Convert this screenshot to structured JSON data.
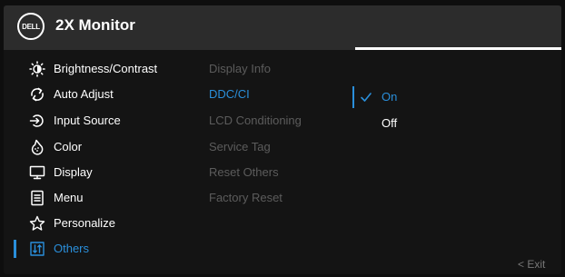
{
  "header": {
    "title": "2X Monitor",
    "logo_text": "DELL",
    "progress_fraction": 0.37
  },
  "nav": {
    "items": [
      {
        "label": "Brightness/Contrast",
        "icon": "brightness-icon"
      },
      {
        "label": "Auto Adjust",
        "icon": "auto-adjust-icon"
      },
      {
        "label": "Input Source",
        "icon": "input-source-icon"
      },
      {
        "label": "Color",
        "icon": "color-icon"
      },
      {
        "label": "Display",
        "icon": "display-icon"
      },
      {
        "label": "Menu",
        "icon": "menu-icon"
      },
      {
        "label": "Personalize",
        "icon": "star-icon"
      },
      {
        "label": "Others",
        "icon": "others-icon",
        "active": true
      }
    ]
  },
  "submenu": {
    "items": [
      {
        "label": "Display Info"
      },
      {
        "label": "DDC/CI",
        "active": true
      },
      {
        "label": "LCD Conditioning"
      },
      {
        "label": "Service Tag"
      },
      {
        "label": "Reset Others"
      },
      {
        "label": "Factory Reset"
      }
    ]
  },
  "values": {
    "items": [
      {
        "label": "On",
        "selected": true
      },
      {
        "label": "Off"
      }
    ]
  },
  "footer": {
    "exit_label": "< Exit"
  },
  "colors": {
    "accent": "#2a8fdb",
    "header_bg": "#2c2c2c",
    "panel_bg": "#141414",
    "dim_text": "#5c5c5c"
  }
}
